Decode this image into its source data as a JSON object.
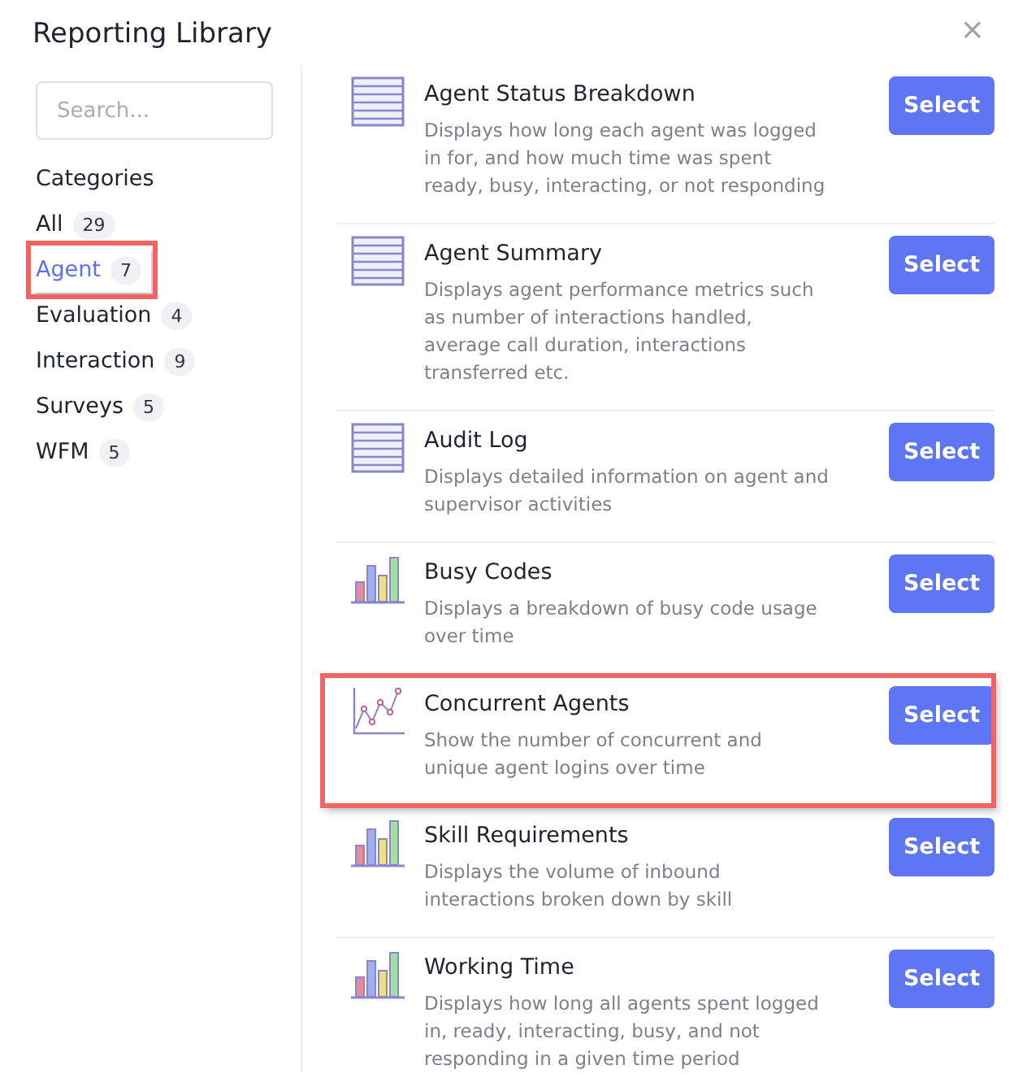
{
  "dialog": {
    "title": "Reporting Library",
    "close": "×"
  },
  "search": {
    "placeholder": "Search..."
  },
  "categories_heading": "Categories",
  "categories": [
    {
      "label": "All",
      "count": "29",
      "selected": false,
      "highlighted": false
    },
    {
      "label": "Agent",
      "count": "7",
      "selected": true,
      "highlighted": true
    },
    {
      "label": "Evaluation",
      "count": "4",
      "selected": false,
      "highlighted": false
    },
    {
      "label": "Interaction",
      "count": "9",
      "selected": false,
      "highlighted": false
    },
    {
      "label": "Surveys",
      "count": "5",
      "selected": false,
      "highlighted": false
    },
    {
      "label": "WFM",
      "count": "5",
      "selected": false,
      "highlighted": false
    }
  ],
  "reports": [
    {
      "kind": "table",
      "title": "Agent Status Breakdown",
      "description": "Displays how long each agent was logged in for, and how much time was spent ready, busy, interacting, or not responding",
      "button": "Select",
      "highlighted": false
    },
    {
      "kind": "table",
      "title": "Agent Summary",
      "description": "Displays agent performance metrics such as number of interactions handled, average call duration, interactions transferred etc.",
      "button": "Select",
      "highlighted": false
    },
    {
      "kind": "table",
      "title": "Audit Log",
      "description": "Displays detailed information on agent and supervisor activities",
      "button": "Select",
      "highlighted": false
    },
    {
      "kind": "bar",
      "title": "Busy Codes",
      "description": "Displays a breakdown of busy code usage over time",
      "button": "Select",
      "highlighted": false
    },
    {
      "kind": "line",
      "title": "Concurrent Agents",
      "description": "Show the number of concurrent and unique agent logins over time",
      "button": "Select",
      "highlighted": true
    },
    {
      "kind": "bar",
      "title": "Skill Requirements",
      "description": "Displays the volume of inbound interactions broken down by skill",
      "button": "Select",
      "highlighted": false
    },
    {
      "kind": "bar",
      "title": "Working Time",
      "description": "Displays how long all agents spent logged in, ready, interacting, busy, and not responding in a given time period",
      "button": "Select",
      "highlighted": false
    }
  ]
}
